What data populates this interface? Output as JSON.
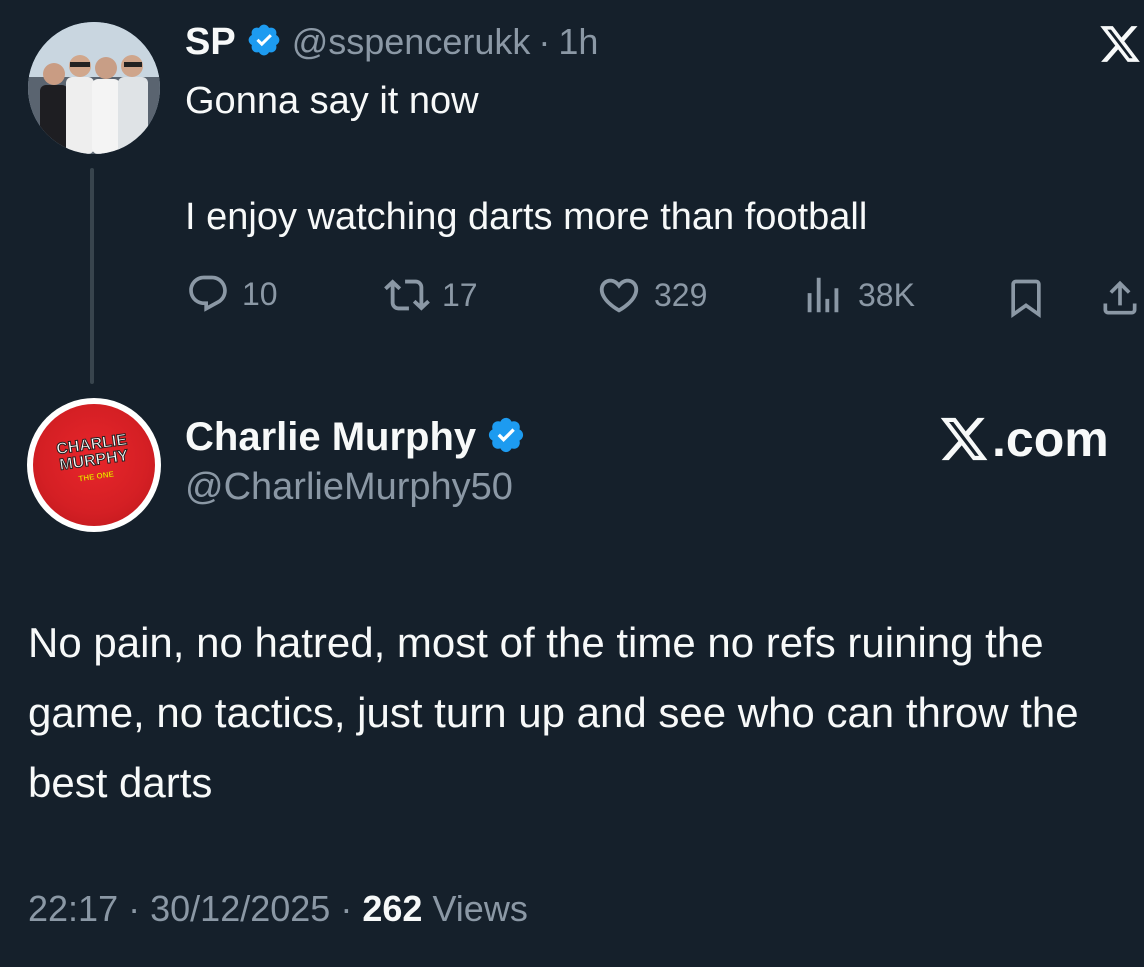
{
  "parent_tweet": {
    "display_name": "SP",
    "handle": "@sspencerukk",
    "separator": "·",
    "time": "1h",
    "text_line_1": "Gonna say it now",
    "text_line_2": "I enjoy watching darts more than football",
    "replies": "10",
    "reposts": "17",
    "likes": "329",
    "views": "38K",
    "verified": true
  },
  "reply_tweet": {
    "display_name": "Charlie Murphy",
    "handle": "@CharlieMurphy50",
    "verified": true,
    "avatar_logo_line1": "CHARLIE",
    "avatar_logo_line2": "MURPHY",
    "avatar_logo_line3": "THE ONE",
    "body": "No pain, no hatred, most of the time no refs ruining the game, no tactics, just turn up and see who can throw the best darts",
    "time": "22:17",
    "date": "30/12/2025",
    "sep1": "·",
    "sep2": "·",
    "view_count": "262",
    "views_label": "Views"
  },
  "branding": {
    "xcom_suffix": ".com"
  },
  "colors": {
    "background": "#15202b",
    "primary_text": "#f7f9f9",
    "secondary_text": "#8b98a5",
    "verified_blue": "#1d9bf0",
    "thread_line": "#38444d",
    "avatar_red": "#d41f24"
  },
  "icons": {
    "reply": "speech-bubble-icon",
    "repost": "repost-arrows-icon",
    "like": "heart-icon",
    "views": "bar-chart-icon",
    "bookmark": "bookmark-icon",
    "share": "share-upload-icon",
    "verified": "verified-badge-icon",
    "brand": "x-logo-icon"
  }
}
